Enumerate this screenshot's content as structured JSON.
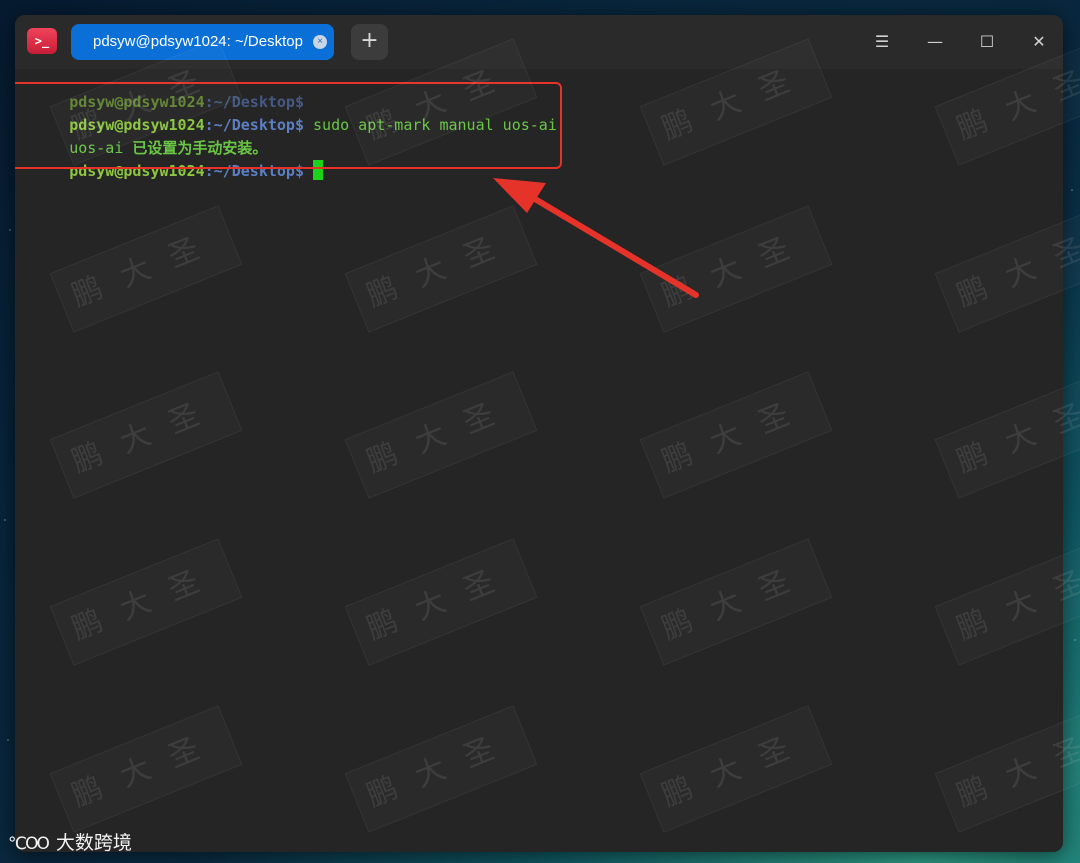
{
  "window": {
    "tab_title": "pdsyw@pdsyw1024: ~/Desktop",
    "tab_close_glyph": "×",
    "new_tab_glyph": "+",
    "menu_glyph": "☰",
    "minimize_glyph": "—",
    "maximize_glyph": "☐",
    "close_glyph": "✕",
    "app_icon_glyph": ">_"
  },
  "terminal": {
    "lines": [
      {
        "user": "pdsyw@pdsyw1024",
        "path": ":~/Desktop",
        "suffix": "$",
        "command": ""
      },
      {
        "user": "pdsyw@pdsyw1024",
        "path": ":~/Desktop",
        "suffix": "$",
        "command": " sudo apt-mark manual uos-ai"
      },
      {
        "output_prefix": "uos-ai ",
        "output_cn": "已设置为手动安装。"
      },
      {
        "user": "pdsyw@pdsyw1024",
        "path": ":~/Desktop",
        "suffix": "$",
        "command": " "
      }
    ]
  },
  "watermark": {
    "text": "鹏大圣"
  },
  "logo": {
    "mark": "℃",
    "mark_digits": "OO",
    "text": "大数跨境"
  },
  "colors": {
    "annotation_red": "#e6332a",
    "tab_blue": "#0a70d8",
    "prompt_green": "#8cc63f",
    "path_blue": "#5c7fc4",
    "cursor_green": "#1ad31a"
  }
}
